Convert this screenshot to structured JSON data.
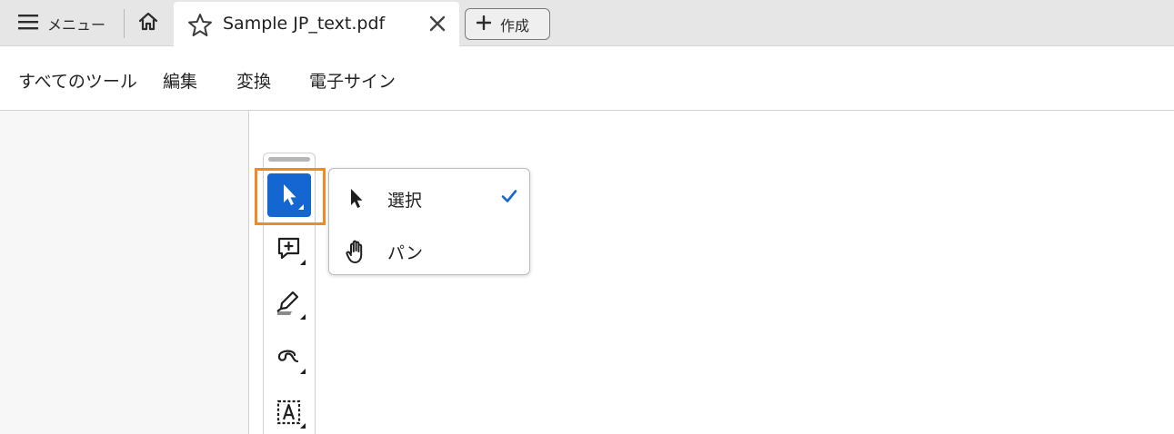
{
  "tabbar": {
    "menu_label": "メニュー",
    "document_tab_title": "Sample JP_text.pdf",
    "create_label": "作成",
    "icons": {
      "menu": "hamburger-icon",
      "home": "home-icon",
      "favorite": "star-icon",
      "close": "close-icon",
      "create": "plus-icon"
    }
  },
  "toolnav": {
    "items": [
      {
        "label": "すべてのツール"
      },
      {
        "label": "編集"
      },
      {
        "label": "変換"
      },
      {
        "label": "電子サイン"
      }
    ]
  },
  "quick_toolbar": {
    "tools": [
      {
        "icon": "cursor-arrow-icon",
        "selected": true
      },
      {
        "icon": "add-comment-icon",
        "selected": false
      },
      {
        "icon": "highlighter-icon",
        "selected": false
      },
      {
        "icon": "freehand-draw-icon",
        "selected": false
      },
      {
        "icon": "text-box-icon",
        "selected": false
      }
    ],
    "selected_color": "#1466d0",
    "highlight_outline_color": "#f08a24"
  },
  "tool_menu": {
    "items": [
      {
        "label": "選択",
        "icon": "cursor-arrow-icon",
        "checked": true
      },
      {
        "label": "パン",
        "icon": "hand-icon",
        "checked": false
      }
    ],
    "check_color": "#1466d0"
  }
}
